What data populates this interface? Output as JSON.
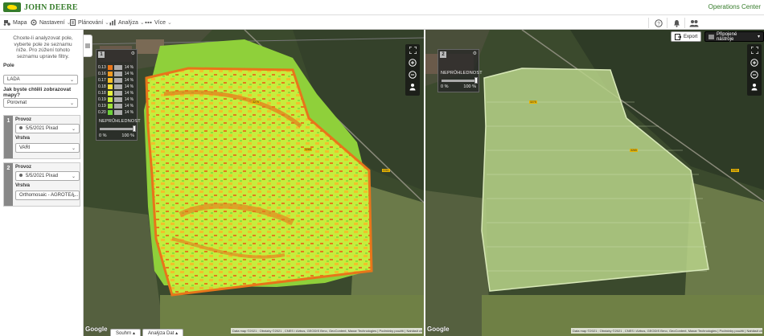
{
  "brand": {
    "logo_text": "JOHN DEERE",
    "app_name": "Operations Center"
  },
  "nav": {
    "items": [
      {
        "label": "Mapa",
        "icon": "tractor-icon"
      },
      {
        "label": "Nastavení",
        "icon": "settings-icon"
      },
      {
        "label": "Plánování",
        "icon": "plan-icon"
      },
      {
        "label": "Analýza",
        "icon": "chart-icon"
      },
      {
        "label": "Více",
        "icon": "dots-icon"
      }
    ],
    "right_icons": [
      "help-icon",
      "notifications-icon",
      "team-icon"
    ]
  },
  "sidebar": {
    "intro": "Chcete-li analyzovat pole, vyberte pole ze seznamu níže. Pro zúžení tohoto seznamu upravte filtry.",
    "field_label": "Pole",
    "field_value": "LADA",
    "question": "Jak byste chtěli zobrazovat mapy?",
    "mode_value": "Porovnat",
    "steps": [
      {
        "num": "1",
        "op_label": "Provoz",
        "op_value": "5/5/2021 Pixad",
        "layer_label": "Vrstva",
        "layer_value": "VARI"
      },
      {
        "num": "2",
        "op_label": "Provoz",
        "op_value": "5/5/2021 Pixad",
        "layer_label": "Vrstva",
        "layer_value": "Orthomosaic - AGROTEA..."
      }
    ]
  },
  "map_left": {
    "badge": "1",
    "legend_values": [
      "0.13",
      "0.16",
      "0.17",
      "0.18",
      "0.18",
      "0.19",
      "0.19",
      "0.20"
    ],
    "legend_pcts": [
      "14 %",
      "14 %",
      "14 %",
      "14 %",
      "14 %",
      "14 %",
      "14 %",
      "14 %"
    ],
    "legend_colors": [
      "#e8751a",
      "#f09a20",
      "#f5c02a",
      "#f8e23a",
      "#e5f03d",
      "#c8ec3a",
      "#9fe23a",
      "#6ed23a"
    ],
    "opacity_label": "NEPRŮHLEDNOST",
    "opacity_min": "0 %",
    "opacity_max": "100 %",
    "opacity": 1.0,
    "road_labels": [
      "3275",
      "3265",
      "2261"
    ]
  },
  "map_right": {
    "badge": "2",
    "opacity_label": "NEPRŮHLEDNOST",
    "opacity_min": "0 %",
    "opacity_max": "100 %",
    "opacity": 1.0,
    "export_label": "Export",
    "tools_label": "Připojené nástroje",
    "road_labels": [
      "3275",
      "3265",
      "2261"
    ]
  },
  "footer": {
    "google": "Google",
    "attribution": "Data map ©2021 ; Obrázky ©2021 , CNES / Airbus, GEODIS Brno, GeoContent, Maxar Technologies | Podmínky použití | Nahlásit chybu v mapě",
    "tabs": [
      {
        "label": "Souhrn"
      },
      {
        "label": "Analýza Dat"
      }
    ]
  },
  "colors": {
    "brand_green": "#367c2b",
    "brand_yellow": "#ffde00"
  }
}
